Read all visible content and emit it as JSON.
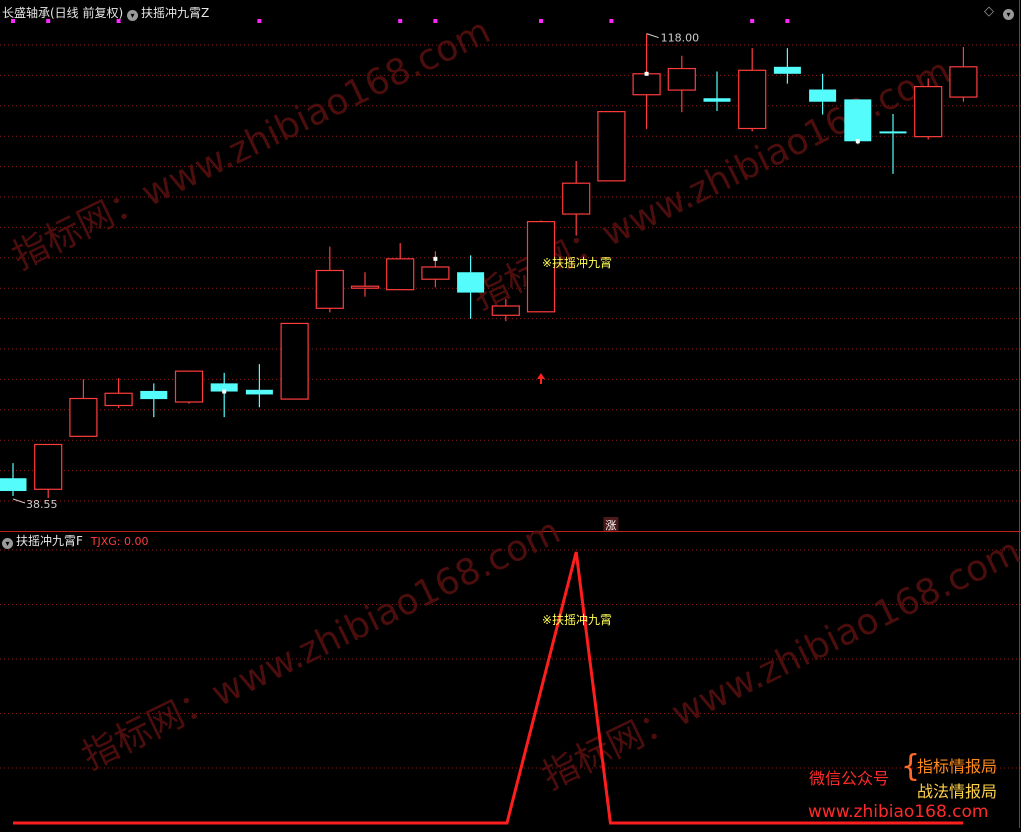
{
  "header": {
    "stock_title": "长盛轴承(日线 前复权)",
    "indicator_main": "扶摇冲九霄Z",
    "indicator_sub": "扶摇冲九霄F",
    "sub_value_label": "TJXG: 0.00",
    "diamond_icon": "diamond-icon",
    "toggle_icon": "chevron-down-icon"
  },
  "colors": {
    "up": "#ff3c3c",
    "down": "#54fcfc",
    "grid": "#8a1a1a",
    "signal_text": "#ffff54",
    "dot": "#ff28ff",
    "line": "#ff1e1e"
  },
  "chart_data": [
    {
      "type": "candlestick",
      "title": "长盛轴承(日线 前复权)",
      "series_name": "扶摇冲九霄Z",
      "price_high_label": "118.00",
      "price_low_label": "38.55",
      "ylim": [
        37,
        120
      ],
      "candles": [
        {
          "o": 41.6,
          "c": 39.4,
          "h": 44.2,
          "l": 38.55
        },
        {
          "o": 39.7,
          "c": 47.4,
          "h": 47.4,
          "l": 38.2
        },
        {
          "o": 48.8,
          "c": 55.3,
          "h": 58.6,
          "l": 48.8
        },
        {
          "o": 54.1,
          "c": 56.2,
          "h": 58.8,
          "l": 53.7
        },
        {
          "o": 56.6,
          "c": 55.2,
          "h": 57.9,
          "l": 52.1
        },
        {
          "o": 54.7,
          "c": 60.0,
          "h": 60.0,
          "l": 54.4
        },
        {
          "o": 57.9,
          "c": 56.5,
          "h": 59.7,
          "l": 52.1
        },
        {
          "o": 56.8,
          "c": 56.0,
          "h": 61.2,
          "l": 53.8
        },
        {
          "o": 55.2,
          "c": 68.2,
          "h": 68.2,
          "l": 55.2
        },
        {
          "o": 70.8,
          "c": 77.3,
          "h": 81.4,
          "l": 70.1
        },
        {
          "o": 74.6,
          "c": 74.6,
          "h": 77.0,
          "l": 72.8
        },
        {
          "o": 74.0,
          "c": 79.3,
          "h": 82.0,
          "l": 74.0
        },
        {
          "o": 75.8,
          "c": 77.9,
          "h": 80.6,
          "l": 74.4
        },
        {
          "o": 77.0,
          "c": 73.5,
          "h": 79.9,
          "l": 69.0
        },
        {
          "o": 69.6,
          "c": 71.2,
          "h": 72.4,
          "l": 68.6
        },
        {
          "o": 70.2,
          "c": 85.7,
          "h": 85.9,
          "l": 70.2
        },
        {
          "o": 87.0,
          "c": 92.3,
          "h": 96.1,
          "l": 83.3
        },
        {
          "o": 92.7,
          "c": 104.6,
          "h": 104.6,
          "l": 92.7
        },
        {
          "o": 107.5,
          "c": 111.1,
          "h": 118.0,
          "l": 101.6
        },
        {
          "o": 108.3,
          "c": 112.0,
          "h": 114.2,
          "l": 104.5
        },
        {
          "o": 106.9,
          "c": 106.3,
          "h": 111.5,
          "l": 104.7
        },
        {
          "o": 101.7,
          "c": 111.7,
          "h": 115.5,
          "l": 101.2
        },
        {
          "o": 112.3,
          "c": 111.1,
          "h": 115.5,
          "l": 109.4
        },
        {
          "o": 108.4,
          "c": 106.3,
          "h": 111.1,
          "l": 104.1
        },
        {
          "o": 106.7,
          "c": 99.5,
          "h": 106.7,
          "l": 99.0
        },
        {
          "o": 101.2,
          "c": 100.9,
          "h": 104.2,
          "l": 93.9
        },
        {
          "o": 100.3,
          "c": 108.9,
          "h": 110.3,
          "l": 99.8
        },
        {
          "o": 107.1,
          "c": 112.3,
          "h": 115.7,
          "l": 106.3
        }
      ],
      "signal": {
        "index": 15,
        "label": "※扶摇冲九霄",
        "marker": "up-arrow"
      },
      "top_dots_indices": [
        0,
        1,
        3,
        7,
        11,
        12,
        15,
        17,
        21,
        22
      ],
      "zhang_badge": {
        "text": "涨",
        "index": 17
      }
    },
    {
      "type": "line",
      "series_name": "TJXG",
      "label": "※扶摇冲九霄",
      "ylim": [
        0,
        1
      ],
      "x": [
        0,
        15,
        16,
        17,
        28
      ],
      "values": [
        0,
        0,
        1,
        0,
        0
      ]
    }
  ],
  "watermark": {
    "text": "指标网：www.zhibiao168.com",
    "promo_line1_a": "微信公众号",
    "promo_line1_b": "指标情报局",
    "promo_line2": "战法情报局",
    "promo_url": "www.zhibiao168.com"
  }
}
